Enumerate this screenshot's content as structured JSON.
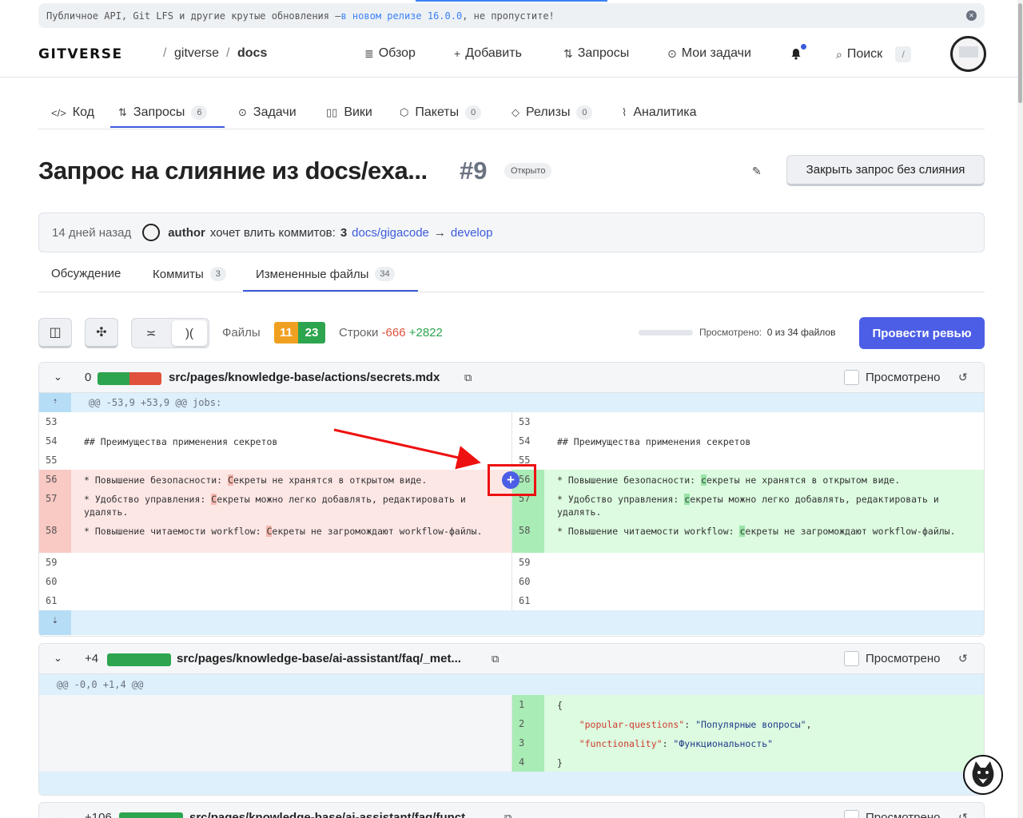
{
  "banner": {
    "text_before": "Публичное API, Git LFS и другие крутые обновления — ",
    "link": "в новом релизе 16.0.0",
    "text_after": ", не пропустите!"
  },
  "header": {
    "logo": "GITVERSE",
    "sep1": "/",
    "org": "gitverse",
    "sep2": "/",
    "repo": "docs",
    "nav": {
      "overview": "Обзор",
      "add": "Добавить",
      "requests": "Запросы",
      "tasks": "Мои задачи",
      "search": "Поиск",
      "search_key": "/"
    }
  },
  "repo_tabs": {
    "code": "Код",
    "requests": "Запросы",
    "requests_count": "6",
    "issues": "Задачи",
    "wiki": "Вики",
    "packages": "Пакеты",
    "packages_count": "0",
    "releases": "Релизы",
    "releases_count": "0",
    "analytics": "Аналитика"
  },
  "pr": {
    "title": "Запрос на слияние из docs/exa...",
    "number": "#9",
    "status": "Открыто",
    "close_button": "Закрыть запрос без слияния",
    "time": "14 дней назад",
    "author": "author",
    "wants": "хочет влить коммитов:",
    "commits": "3",
    "source": "docs/gigacode",
    "arrow": "→",
    "target": "develop"
  },
  "sub_tabs": {
    "discussion": "Обсуждение",
    "commits": "Коммиты",
    "commits_count": "3",
    "files": "Измененные файлы",
    "files_count": "34"
  },
  "toolbar": {
    "files_label": "Файлы",
    "files_changed": "11",
    "files_added": "23",
    "lines_label": "Строки",
    "lines_removed": "-666",
    "lines_added": "+2822",
    "viewed_label": "Просмотрено:",
    "viewed_value": "0 из 34 файлов",
    "review_button": "Провести ревью"
  },
  "file1": {
    "count": "0",
    "name": "src/pages/knowledge-base/actions/secrets.mdx",
    "viewed": "Просмотрено",
    "hunk": "@@ -53,9 +53,9 @@ jobs:",
    "context": [
      {
        "ln": "53",
        "text": ""
      },
      {
        "ln": "54",
        "text": "## Преимущества применения секретов"
      },
      {
        "ln": "55",
        "text": ""
      }
    ],
    "changed": [
      {
        "ln": "56",
        "pre": "* Повышение безопасности: ",
        "old_hl": "С",
        "new_hl": "с",
        "rest": "екреты не хранятся в открытом виде."
      },
      {
        "ln": "57",
        "pre": "* Удобство управления: ",
        "old_hl": "С",
        "new_hl": "с",
        "rest": "екреты можно легко добавлять, редактировать и удалять."
      },
      {
        "ln": "58",
        "pre": "* Повышение читаемости workflow: ",
        "old_hl": "С",
        "new_hl": "с",
        "rest": "екреты не загромождают workflow-файлы."
      }
    ],
    "trailing": [
      {
        "ln": "59"
      },
      {
        "ln": "60"
      },
      {
        "ln": "61"
      }
    ]
  },
  "file2": {
    "count": "+4",
    "name": "src/pages/knowledge-base/ai-assistant/faq/_met...",
    "viewed": "Просмотрено",
    "hunk": "@@ -0,0 +1,4 @@",
    "lines": [
      {
        "ln": "1",
        "text": "{"
      },
      {
        "ln": "2",
        "key": "\"popular-questions\"",
        "sep": ": ",
        "val": "\"Популярные вопросы\"",
        "end": ","
      },
      {
        "ln": "3",
        "key": "\"functionality\"",
        "sep": ": ",
        "val": "\"Функциональность\"",
        "end": ""
      },
      {
        "ln": "4",
        "text": "}"
      }
    ]
  },
  "file3": {
    "count": "+106",
    "name": "src/pages/knowledge-base/ai-assistant/faq/funct...",
    "viewed": "Просмотрено"
  },
  "colors": {
    "accent": "#4c5ee6",
    "added": "#2da44e",
    "removed": "#e0523c",
    "changed": "#f0a020"
  }
}
